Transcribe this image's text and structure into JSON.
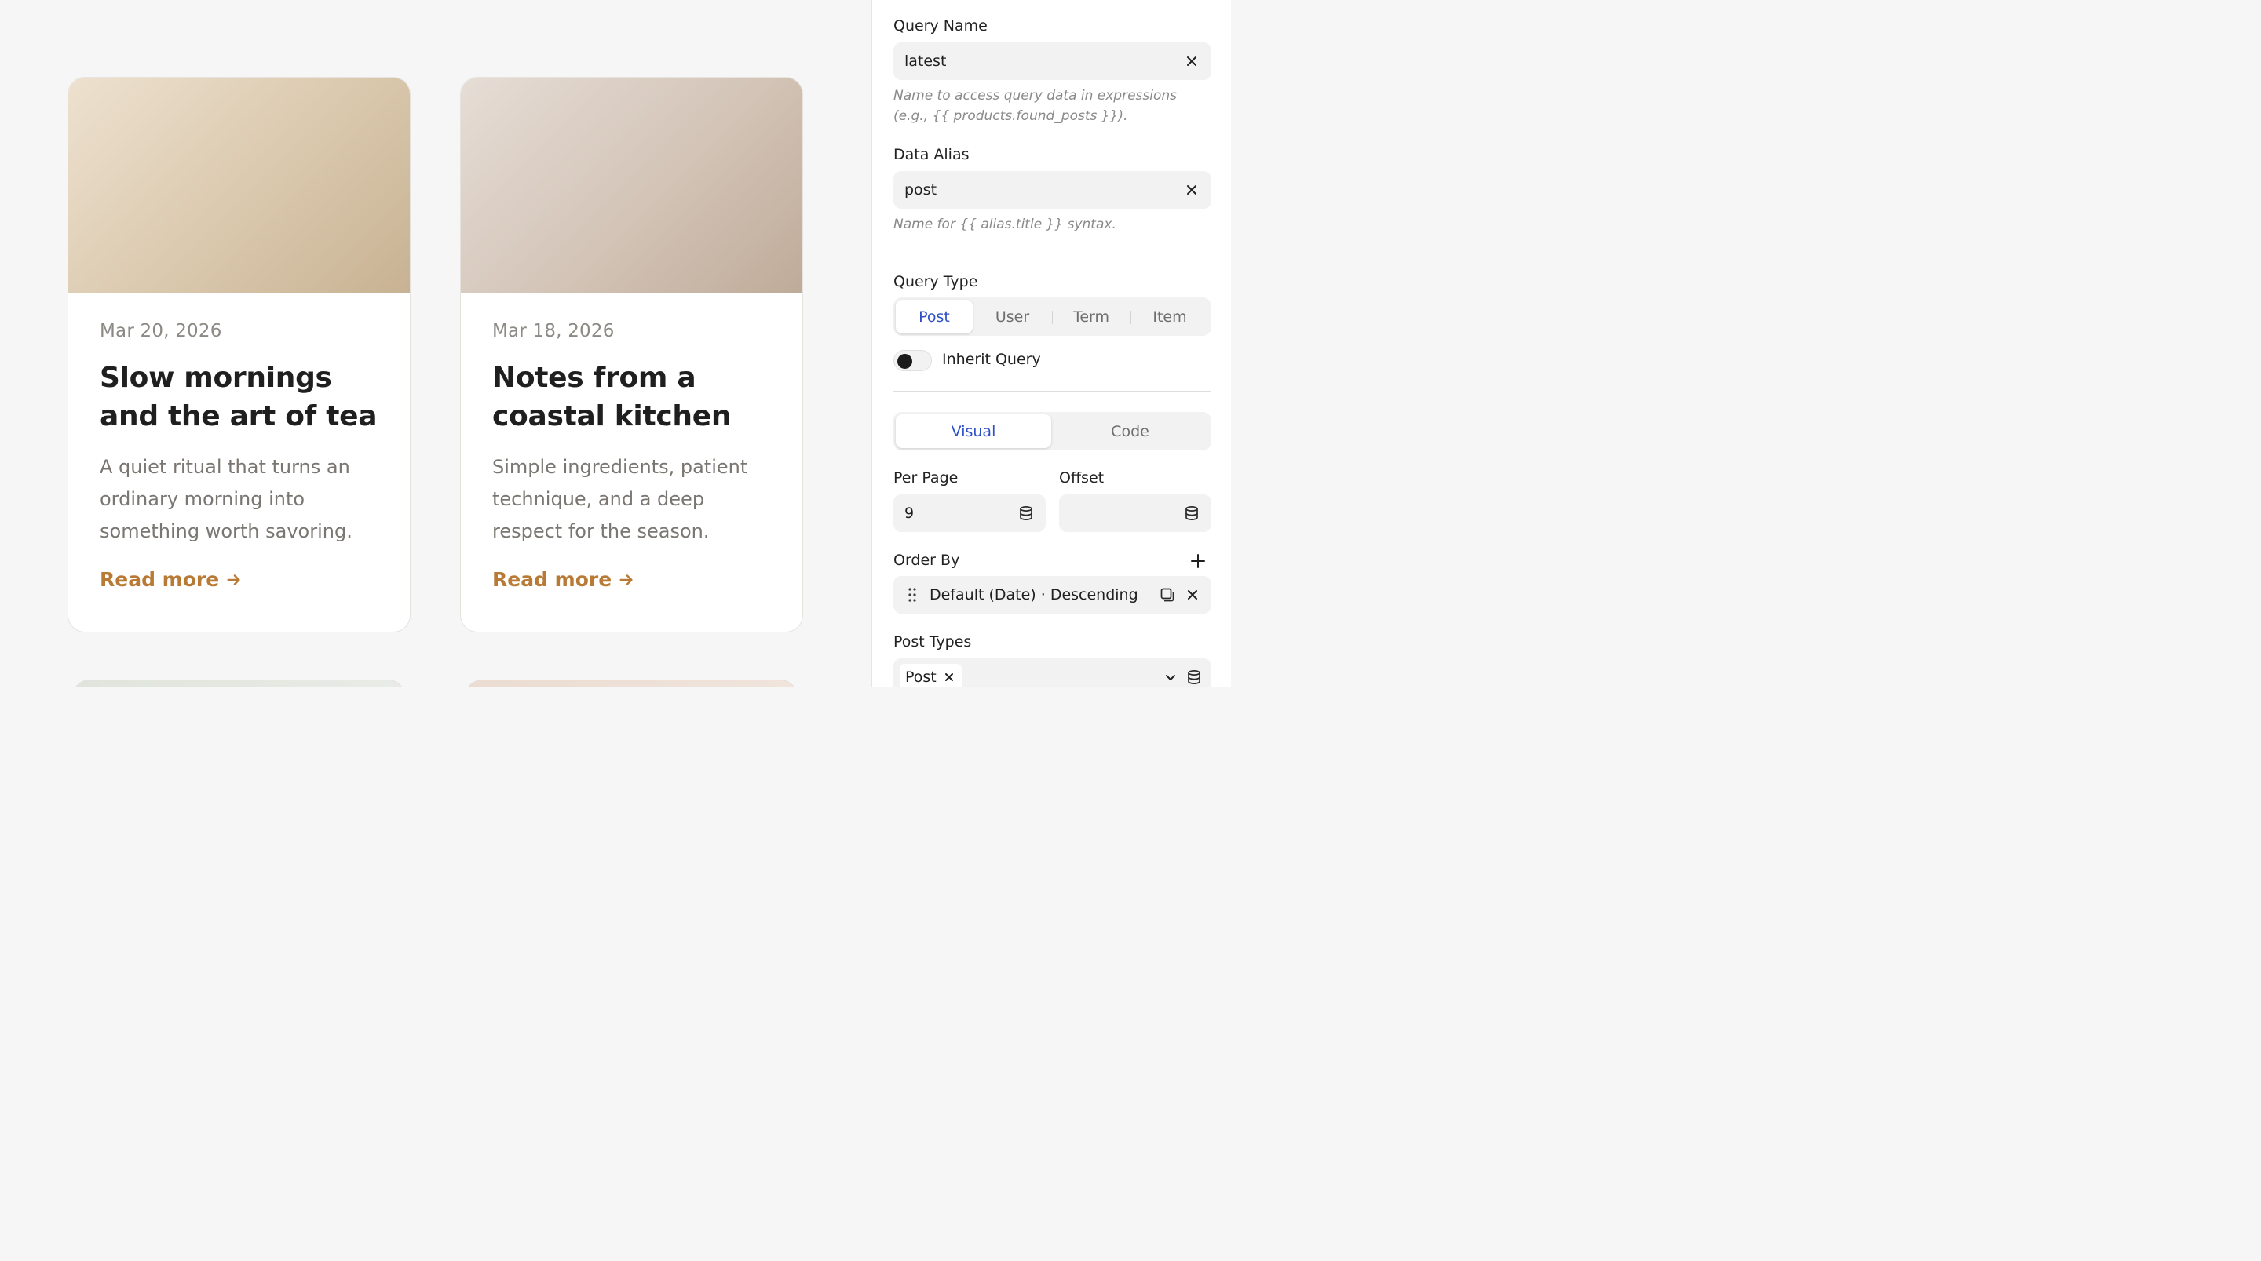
{
  "cards": [
    {
      "date": "Mar 20, 2026",
      "title": "Slow mornings and the art of tea",
      "excerpt": "A quiet ritual that turns an ordinary morning into something worth savoring.",
      "link_label": "Read more"
    },
    {
      "date": "Mar 18, 2026",
      "title": "Notes from a coastal kitchen",
      "excerpt": "Simple ingredients, patient technique, and a deep respect for the season.",
      "link_label": "Read more"
    }
  ],
  "panel": {
    "query_name": {
      "label": "Query Name",
      "value": "latest",
      "hint": "Name to access query data in expressions (e.g., {{ products.found_posts }})."
    },
    "data_alias": {
      "label": "Data Alias",
      "value": "post",
      "hint": "Name for {{ alias.title }} syntax."
    },
    "query_type": {
      "label": "Query Type",
      "options": [
        "Post",
        "User",
        "Term",
        "Item"
      ],
      "selected": "Post"
    },
    "inherit_query": {
      "label": "Inherit Query",
      "enabled": false
    },
    "mode_tabs": {
      "options": [
        "Visual",
        "Code"
      ],
      "selected": "Visual"
    },
    "per_page": {
      "label": "Per Page",
      "value": "9"
    },
    "offset": {
      "label": "Offset",
      "value": ""
    },
    "order_by": {
      "label": "Order By",
      "items": [
        "Default (Date) · Descending"
      ]
    },
    "post_types": {
      "label": "Post Types",
      "chips": [
        "Post"
      ]
    }
  },
  "icons": {
    "clear": "close-icon",
    "dynamic_data": "database-icon",
    "add": "plus-icon",
    "drag": "drag-handle-icon",
    "duplicate": "duplicate-icon",
    "dropdown": "chevron-down-icon",
    "arrow": "arrow-right-icon"
  },
  "colors": {
    "accent_link": "#b87a35",
    "active_tab": "#2f4fc7",
    "toggle_knob": "#1c1c1c"
  }
}
